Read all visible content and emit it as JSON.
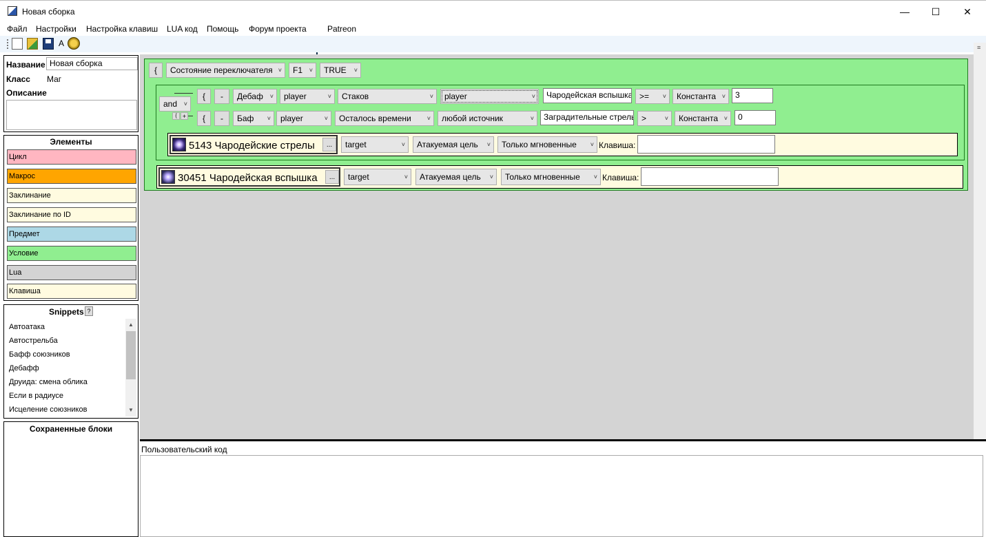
{
  "window": {
    "title": "Новая сборка",
    "minimize": "—",
    "maximize": "☐",
    "close": "✕"
  },
  "menu": [
    "Файл",
    "Настройки",
    "Настройка клавиш",
    "LUA код",
    "Помощь",
    "Форум проекта",
    "Patreon"
  ],
  "toolbar": {
    "font_button": "A"
  },
  "info": {
    "name_label": "Название",
    "name_value": "Новая сборка",
    "class_label": "Класс",
    "class_value": "Маг",
    "desc_label": "Описание"
  },
  "elements": {
    "title": "Элементы",
    "items": [
      {
        "label": "Цикл",
        "color": "#ffb6c1"
      },
      {
        "label": "Макрос",
        "color": "#ffa500"
      },
      {
        "label": "Заклинание",
        "color": "#fffbe0"
      },
      {
        "label": "Заклинание по ID",
        "color": "#fffbe0"
      },
      {
        "label": "Предмет",
        "color": "#add8e6"
      },
      {
        "label": "Условие",
        "color": "#90ee90"
      },
      {
        "label": "Lua",
        "color": "#d3d3d3"
      },
      {
        "label": "Клавиша",
        "color": "#fffbe0"
      }
    ]
  },
  "snippets": {
    "title": "Snippets",
    "help": "?",
    "items": [
      "Автоатака",
      "Автострельба",
      "Бафф союзников",
      "Дебафф",
      "Друида: смена облика",
      "Если в радиусе",
      "Исцеление союзников"
    ]
  },
  "saved": {
    "title": "Сохраненные блоки"
  },
  "editor": {
    "brace": "{",
    "minus": "-",
    "plus": "+",
    "ellipsis": "...",
    "dropdown_arrow": "˅",
    "top": {
      "state": "Состояние переключателя",
      "key": "F1",
      "value": "TRUE"
    },
    "logic": "and",
    "cond1": {
      "type": "Дебаф",
      "unit": "player",
      "prop": "Стаков",
      "source": "player",
      "spell": "Чародейская вспышка",
      "op": ">=",
      "kind": "Константа",
      "value": "3"
    },
    "cond2": {
      "type": "Баф",
      "unit": "player",
      "prop": "Осталось времени",
      "source": "любой источник",
      "spell": "Заградительные стрелы",
      "op": ">",
      "kind": "Константа",
      "value": "0"
    },
    "spell1": {
      "name": "5143 Чародейские стрелы",
      "target": "target",
      "check": "Атакуемая цель",
      "mode": "Только мгновенные",
      "key_label": "Клавиша:"
    },
    "spell2": {
      "name": "30451 Чародейская вспышка",
      "target": "target",
      "check": "Атакуемая цель",
      "mode": "Только мгновенные",
      "key_label": "Клавиша:"
    }
  },
  "usercode": {
    "label": "Пользовательский код"
  }
}
